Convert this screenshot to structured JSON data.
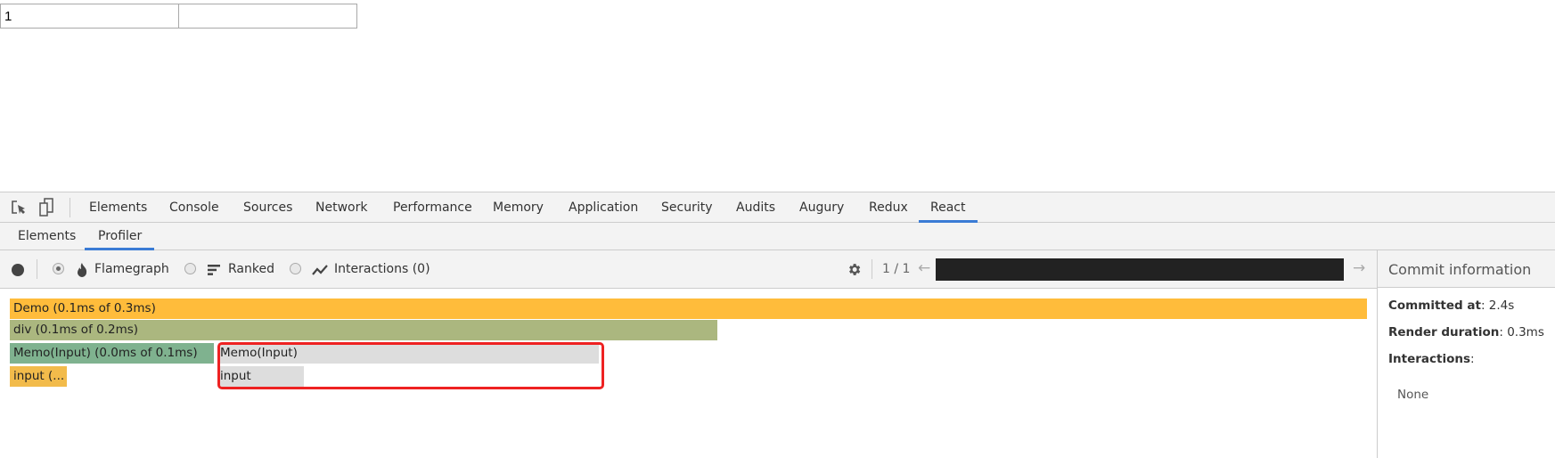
{
  "page": {
    "input1_value": "1",
    "input2_value": ""
  },
  "devtools": {
    "tabs": [
      "Elements",
      "Console",
      "Sources",
      "Network",
      "Performance",
      "Memory",
      "Application",
      "Security",
      "Audits",
      "Augury",
      "Redux",
      "React"
    ],
    "active_tab": "React",
    "subtabs": [
      "Elements",
      "Profiler"
    ],
    "active_subtab": "Profiler",
    "toolbar": {
      "flamegraph": "Flamegraph",
      "ranked": "Ranked",
      "interactions": "Interactions (0)",
      "commit_counter": "1 / 1",
      "selected_view": "Flamegraph"
    },
    "flamegraph": [
      {
        "label": "Demo (0.1ms of 0.3ms)",
        "color": "#ffbc3b"
      },
      {
        "label": "div (0.1ms of 0.2ms)",
        "color": "#abb77f"
      },
      {
        "label": "Memo(Input) (0.0ms of 0.1ms)",
        "color": "#7fb28f"
      },
      {
        "label": "Memo(Input)",
        "color": "#dddddd"
      },
      {
        "label": "input (...",
        "color": "#f2bb4b"
      },
      {
        "label": "input",
        "color": "#dddddd"
      }
    ],
    "highlight_color": "#ee2222",
    "commit_info": {
      "title": "Commit information",
      "committed_label": "Committed at",
      "committed_value": ": 2.4s",
      "render_label": "Render duration",
      "render_value": ": 0.3ms",
      "interactions_label": "Interactions",
      "interactions_colon": ":",
      "interactions_value": "None"
    },
    "accent": "#3a7bd5"
  }
}
